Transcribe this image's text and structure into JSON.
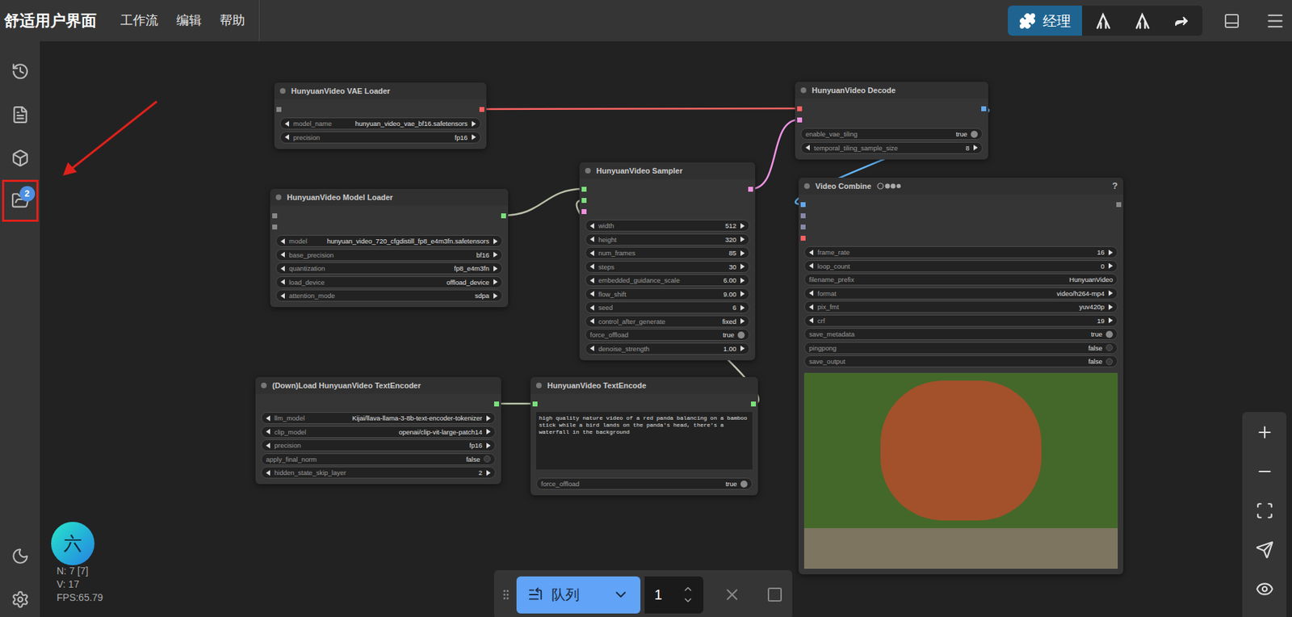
{
  "topbar": {
    "title": "舒适用户界面",
    "menu": [
      "工作流",
      "编辑",
      "帮助"
    ],
    "manager_button": "经理"
  },
  "sidebar": {
    "items": [
      {
        "badge": "",
        "highlighted": false
      },
      {
        "badge": "",
        "highlighted": false
      },
      {
        "badge": "",
        "highlighted": false
      },
      {
        "badge": "2",
        "highlighted": true
      }
    ]
  },
  "nodes": [
    {
      "title": "HunyuanVideo VAE Loader",
      "help": "",
      "inputs": [
        "#888888"
      ],
      "outputs": [
        "#ff6060"
      ],
      "prompt": "",
      "preview": false,
      "widgets": [
        {
          "label": "model_name",
          "value": "hunyuan_video_vae_bf16.safetensors",
          "kind": "combo",
          "on": false
        },
        {
          "label": "precision",
          "value": "fp16",
          "kind": "combo",
          "on": false
        }
      ]
    },
    {
      "title": "HunyuanVideo Model Loader",
      "help": "",
      "inputs": [
        "#888888",
        "#888888"
      ],
      "outputs": [
        "#7ddf7d"
      ],
      "prompt": "",
      "preview": false,
      "widgets": [
        {
          "label": "model",
          "value": "hunyuan_video_720_cfgdistill_fp8_e4m3fn.safetensors",
          "kind": "combo",
          "on": false
        },
        {
          "label": "base_precision",
          "value": "bf16",
          "kind": "combo",
          "on": false
        },
        {
          "label": "quantization",
          "value": "fp8_e4m3fn",
          "kind": "combo",
          "on": false
        },
        {
          "label": "load_device",
          "value": "offload_device",
          "kind": "combo",
          "on": false
        },
        {
          "label": "attention_mode",
          "value": "sdpa",
          "kind": "combo",
          "on": false
        }
      ]
    },
    {
      "title": "HunyuanVideo Sampler",
      "help": "",
      "inputs": [
        "#7ddf7d",
        "#7ddf7d",
        "#f090e0"
      ],
      "outputs": [
        "#f090e0"
      ],
      "prompt": "",
      "preview": false,
      "widgets": [
        {
          "label": "width",
          "value": "512",
          "kind": "combo",
          "on": false
        },
        {
          "label": "height",
          "value": "320",
          "kind": "combo",
          "on": false
        },
        {
          "label": "num_frames",
          "value": "85",
          "kind": "combo",
          "on": false
        },
        {
          "label": "steps",
          "value": "30",
          "kind": "combo",
          "on": false
        },
        {
          "label": "embedded_guidance_scale",
          "value": "6.00",
          "kind": "combo",
          "on": false
        },
        {
          "label": "flow_shift",
          "value": "9.00",
          "kind": "combo",
          "on": false
        },
        {
          "label": "seed",
          "value": "6",
          "kind": "combo",
          "on": false
        },
        {
          "label": "control_after_generate",
          "value": "fixed",
          "kind": "combo",
          "on": false
        },
        {
          "label": "force_offload",
          "value": "true",
          "kind": "toggle",
          "on": true
        },
        {
          "label": "denoise_strength",
          "value": "1.00",
          "kind": "combo",
          "on": false
        }
      ]
    },
    {
      "title": "HunyuanVideo Decode",
      "help": "",
      "inputs": [
        "#ff6060",
        "#f090e0"
      ],
      "outputs": [
        "#64a8f0"
      ],
      "prompt": "",
      "preview": false,
      "widgets": [
        {
          "label": "enable_vae_tiling",
          "value": "true",
          "kind": "toggle",
          "on": true
        },
        {
          "label": "temporal_tiling_sample_size",
          "value": "8",
          "kind": "combo",
          "on": false
        }
      ]
    },
    {
      "title": "Video Combine",
      "help": "?",
      "inputs": [
        "#64a8f0",
        "#8888aa",
        "#8888aa",
        "#ff6060"
      ],
      "outputs": [
        "#888888"
      ],
      "prompt": "",
      "preview": true,
      "widgets": [
        {
          "label": "frame_rate",
          "value": "16",
          "kind": "combo",
          "on": false
        },
        {
          "label": "loop_count",
          "value": "0",
          "kind": "combo",
          "on": false
        },
        {
          "label": "filename_prefix",
          "value": "HunyuanVideo",
          "kind": "text",
          "on": false
        },
        {
          "label": "format",
          "value": "video/h264-mp4",
          "kind": "combo",
          "on": false
        },
        {
          "label": "pix_fmt",
          "value": "yuv420p",
          "kind": "combo",
          "on": false
        },
        {
          "label": "crf",
          "value": "19",
          "kind": "combo",
          "on": false
        },
        {
          "label": "save_metadata",
          "value": "true",
          "kind": "toggle",
          "on": true
        },
        {
          "label": "pingpong",
          "value": "false",
          "kind": "toggle",
          "on": false
        },
        {
          "label": "save_output",
          "value": "false",
          "kind": "toggle",
          "on": false
        }
      ]
    },
    {
      "title": "(Down)Load HunyuanVideo TextEncoder",
      "help": "",
      "inputs": [],
      "outputs": [
        "#7ddf7d"
      ],
      "prompt": "",
      "preview": false,
      "widgets": [
        {
          "label": "llm_model",
          "value": "Kijai/llava-llama-3-8b-text-encoder-tokenizer",
          "kind": "combo",
          "on": false
        },
        {
          "label": "clip_model",
          "value": "openai/clip-vit-large-patch14",
          "kind": "combo",
          "on": false
        },
        {
          "label": "precision",
          "value": "fp16",
          "kind": "combo",
          "on": false
        },
        {
          "label": "apply_final_norm",
          "value": "false",
          "kind": "toggle",
          "on": false
        },
        {
          "label": "hidden_state_skip_layer",
          "value": "2",
          "kind": "combo",
          "on": false
        }
      ]
    },
    {
      "title": "HunyuanVideo TextEncode",
      "help": "",
      "inputs": [
        "#7ddf7d"
      ],
      "outputs": [
        "#7ddf7d"
      ],
      "prompt": "high quality nature video of a red panda balancing on a bamboo stick while a bird lands on the panda's head, there's a waterfall in the background",
      "preview": false,
      "widgets": [
        {
          "label": "force_offload",
          "value": "true",
          "kind": "toggle",
          "on": true
        }
      ]
    }
  ],
  "queue": {
    "button": "队列",
    "count": "1"
  },
  "avatar": "六",
  "stats": [
    "N: 7 [7]",
    "V: 17",
    "FPS:65.79"
  ]
}
